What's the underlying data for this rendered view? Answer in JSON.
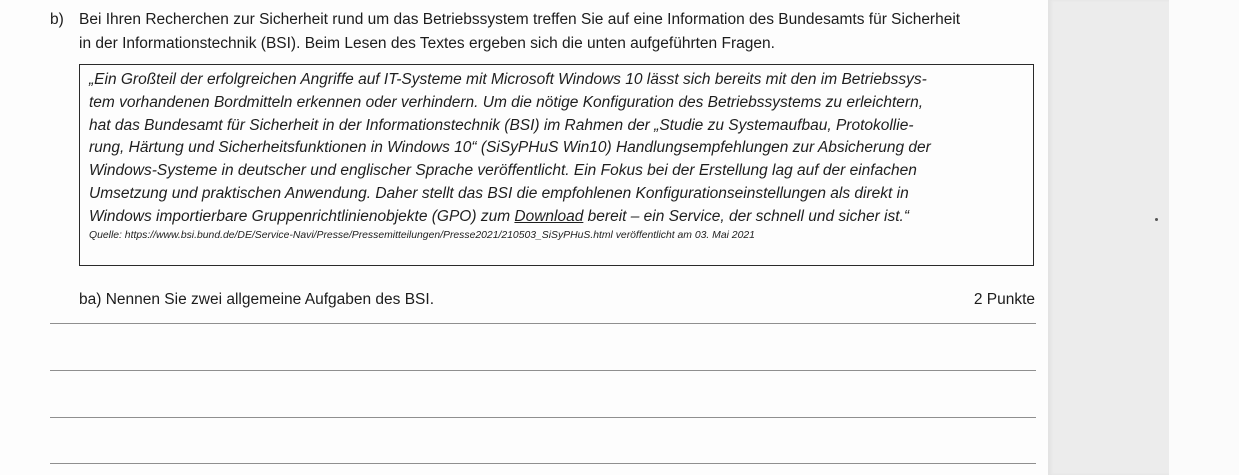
{
  "question": {
    "letter": "b)",
    "text_line1": "Bei Ihren Recherchen zur Sicherheit rund um das Betriebssystem treffen Sie auf eine Information des Bundesamts für Sicherheit",
    "text_line2": "in der Informationstechnik (BSI). Beim Lesen des Textes ergeben sich die unten aufgeführten Fragen."
  },
  "quote": {
    "line1": "„Ein Großteil der erfolgreichen Angriffe auf IT-Systeme mit Microsoft Windows 10 lässt sich bereits mit den im Betriebssys-",
    "line2": "tem vorhandenen Bordmitteln erkennen oder verhindern. Um die nötige Konfiguration des Betriebssystems zu erleichtern,",
    "line3": "hat das Bundesamt für Sicherheit in der Informationstechnik (BSI) im Rahmen der „Studie zu Systemaufbau, Protokollie-",
    "line4": "rung, Härtung und Sicherheitsfunktionen in Windows 10“ (SiSyPHuS Win10) Handlungsempfehlungen zur Absicherung der",
    "line5": "Windows-Systeme in deutscher und englischer Sprache veröffentlicht. Ein Fokus bei der Erstellung lag auf der einfachen",
    "line6": "Umsetzung und praktischen Anwendung. Daher stellt das BSI die empfohlenen Konfigurationseinstellungen als direkt in",
    "line7_before": "Windows importierbare Gruppenrichtlinienobjekte (GPO) zum ",
    "line7_link": "Download",
    "line7_after": " bereit – ein Service, der schnell und sicher ist.“",
    "source": "Quelle: https://www.bsi.bund.de/DE/Service-Navi/Presse/Pressemitteilungen/Presse2021/210503_SiSyPHuS.html veröffentlicht am 03. Mai 2021"
  },
  "subquestion": {
    "label": "ba) Nennen Sie zwei allgemeine Aufgaben des BSI.",
    "points": "2 Punkte"
  }
}
